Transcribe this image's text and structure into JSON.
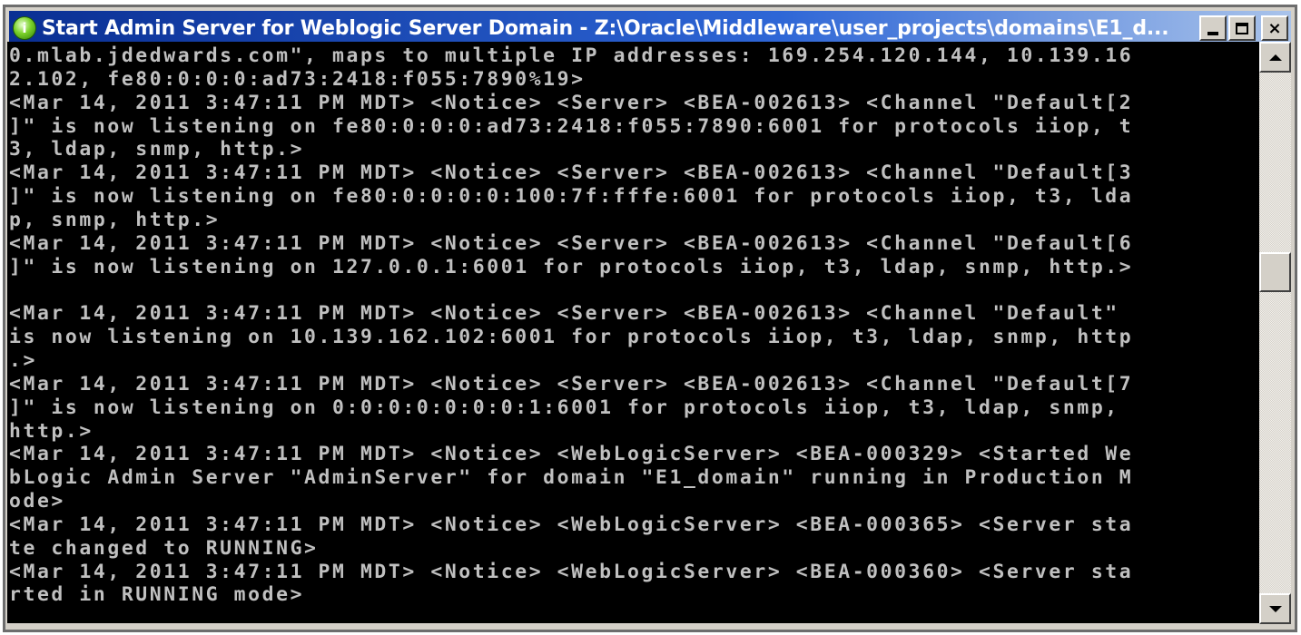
{
  "window": {
    "title": "Start Admin Server for Weblogic Server Domain - Z:\\Oracle\\Middleware\\user_projects\\domains\\E1_d...",
    "icon": "weblogic-server-icon",
    "controls": {
      "minimize_icon": "minimize-icon",
      "maximize_icon": "maximize-icon",
      "close_label": "×"
    }
  },
  "console": {
    "lines": [
      "0.mlab.jdedwards.com\", maps to multiple IP addresses: 169.254.120.144, 10.139.16",
      "2.102, fe80:0:0:0:ad73:2418:f055:7890%19>",
      "<Mar 14, 2011 3:47:11 PM MDT> <Notice> <Server> <BEA-002613> <Channel \"Default[2",
      "]\" is now listening on fe80:0:0:0:ad73:2418:f055:7890:6001 for protocols iiop, t",
      "3, ldap, snmp, http.>",
      "<Mar 14, 2011 3:47:11 PM MDT> <Notice> <Server> <BEA-002613> <Channel \"Default[3",
      "]\" is now listening on fe80:0:0:0:0:100:7f:fffe:6001 for protocols iiop, t3, lda",
      "p, snmp, http.>",
      "<Mar 14, 2011 3:47:11 PM MDT> <Notice> <Server> <BEA-002613> <Channel \"Default[6",
      "]\" is now listening on 127.0.0.1:6001 for protocols iiop, t3, ldap, snmp, http.>",
      "",
      "<Mar 14, 2011 3:47:11 PM MDT> <Notice> <Server> <BEA-002613> <Channel \"Default\"",
      "is now listening on 10.139.162.102:6001 for protocols iiop, t3, ldap, snmp, http",
      ".>",
      "<Mar 14, 2011 3:47:11 PM MDT> <Notice> <Server> <BEA-002613> <Channel \"Default[7",
      "]\" is now listening on 0:0:0:0:0:0:0:1:6001 for protocols iiop, t3, ldap, snmp,",
      "http.>",
      "<Mar 14, 2011 3:47:11 PM MDT> <Notice> <WebLogicServer> <BEA-000329> <Started We",
      "bLogic Admin Server \"AdminServer\" for domain \"E1_domain\" running in Production M",
      "ode>",
      "<Mar 14, 2011 3:47:11 PM MDT> <Notice> <WebLogicServer> <BEA-000365> <Server sta",
      "te changed to RUNNING>",
      "<Mar 14, 2011 3:47:11 PM MDT> <Notice> <WebLogicServer> <BEA-000360> <Server sta",
      "rted in RUNNING mode>"
    ],
    "highlighted_text": "in RUNNING mode>",
    "text_color": "#c0c0c0",
    "background_color": "#000000",
    "highlight_color": "#c2281f"
  },
  "scrollbar": {
    "up_icon": "scroll-up-arrow-icon",
    "down_icon": "scroll-down-arrow-icon"
  }
}
